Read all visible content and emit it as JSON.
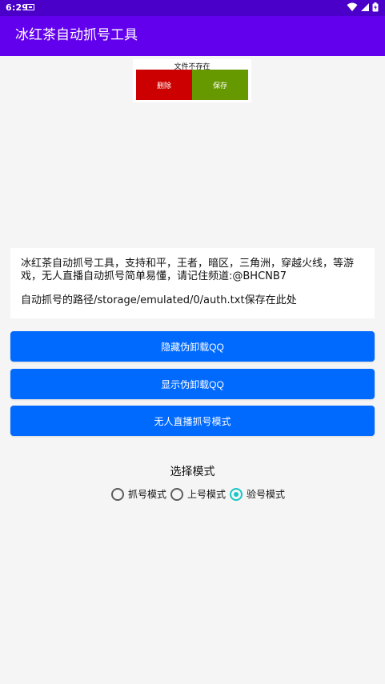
{
  "status_bar": {
    "time": "6:29"
  },
  "app_bar": {
    "title": "冰红茶自动抓号工具"
  },
  "banner": {
    "title": "文件不存在",
    "delete_label": "删除",
    "save_label": "保存"
  },
  "info": {
    "line1": "冰红茶自动抓号工具，支持和平，王者，暗区，三角洲，穿越火线，等游",
    "line2": "戏，无人直播自动抓号简单易懂，请记住频道:@BHCNB7",
    "path": "自动抓号的路径/storage/emulated/0/auth.txt保存在此处"
  },
  "buttons": [
    {
      "label": "隐藏伪卸载QQ"
    },
    {
      "label": "显示伪卸载QQ"
    },
    {
      "label": "无人直播抓号模式"
    }
  ],
  "mode": {
    "title": "选择模式",
    "options": [
      {
        "label": "抓号模式"
      },
      {
        "label": "上号模式"
      },
      {
        "label": "验号模式"
      }
    ],
    "selected": "验号模式"
  },
  "colors": {
    "status_bar": "#4a00c8",
    "app_bar": "#6200ee",
    "button": "#006aff",
    "delete": "#cc0000",
    "save": "#669900",
    "radio_checked": "#19c6c6"
  }
}
